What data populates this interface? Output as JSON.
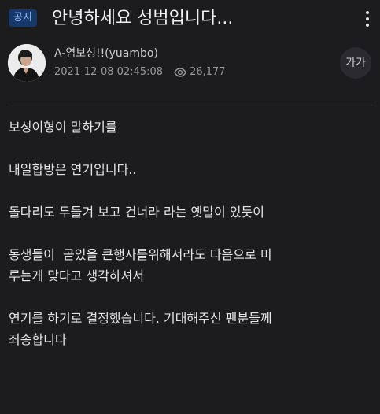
{
  "header": {
    "badge": "공지",
    "title": "안녕하세요 성범입니다...",
    "more_icon": "more-vertical-icon"
  },
  "author": {
    "name": "A-염보성!!(yuambo)",
    "date": "2021-12-08 02:45:08",
    "views": "26,177",
    "view_icon": "eye-icon",
    "font_size_label": "가가"
  },
  "content": {
    "paragraphs": [
      {
        "lines": [
          "보성이형이 말하기를"
        ]
      },
      {
        "lines": [
          "내일합방은 연기입니다.."
        ]
      },
      {
        "lines": [
          "돌다리도 두들겨 보고 건너라 라는 옛말이 있듯이"
        ]
      },
      {
        "lines": [
          "동생들이  곧있을 큰행사를위해서라도 다음으로 미",
          "루는게 맞다고 생각하셔서"
        ]
      },
      {
        "lines": [
          "연기를 하기로 결정했습니다. 기대해주신 팬분들께",
          "죄송합니다"
        ]
      }
    ]
  },
  "colors": {
    "background": "#1c1c1f",
    "badge_bg": "#17396a",
    "badge_text": "#8fb8ff",
    "text": "#e6e6e6",
    "meta_text": "#9a9a9a"
  }
}
